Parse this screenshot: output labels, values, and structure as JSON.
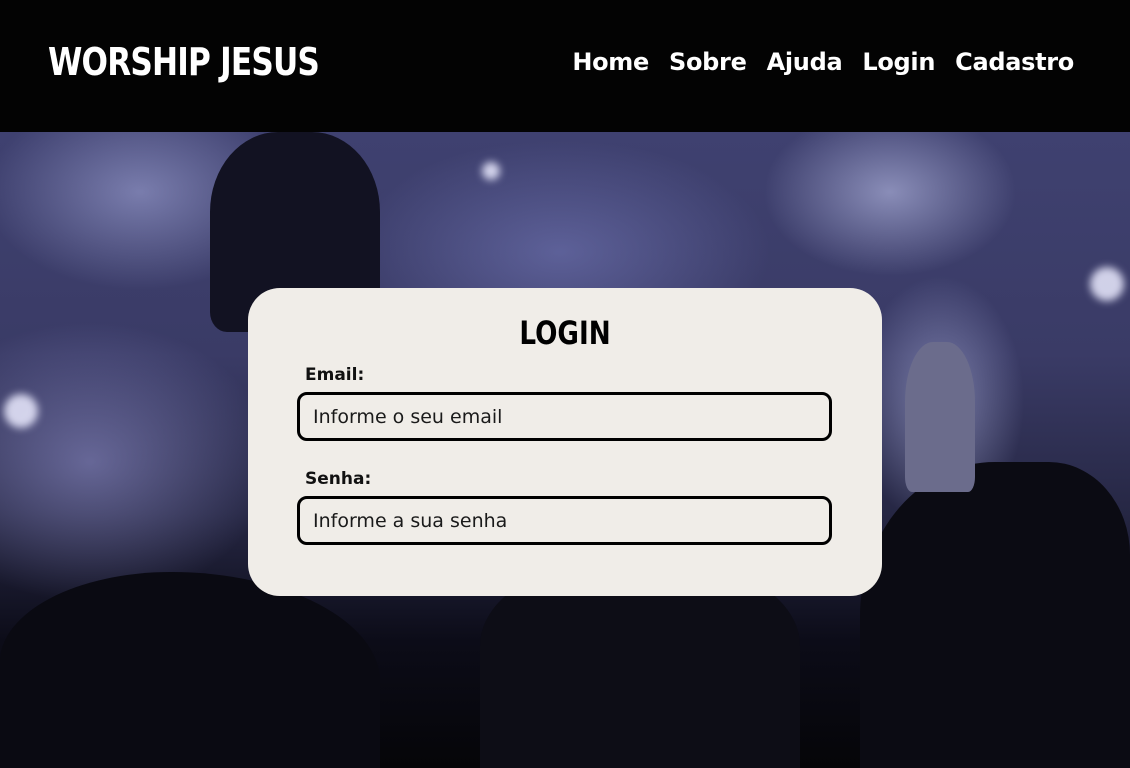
{
  "header": {
    "brand": "WORSHIP JESUS",
    "nav": [
      "Home",
      "Sobre",
      "Ajuda",
      "Login",
      "Cadastro"
    ]
  },
  "login": {
    "title": "LOGIN",
    "email_label": "Email:",
    "email_placeholder": "Informe o seu email",
    "password_label": "Senha:",
    "password_placeholder": "Informe a sua senha"
  },
  "colors": {
    "header_bg": "#030303",
    "card_bg": "#f0ede8",
    "text": "#000000"
  }
}
